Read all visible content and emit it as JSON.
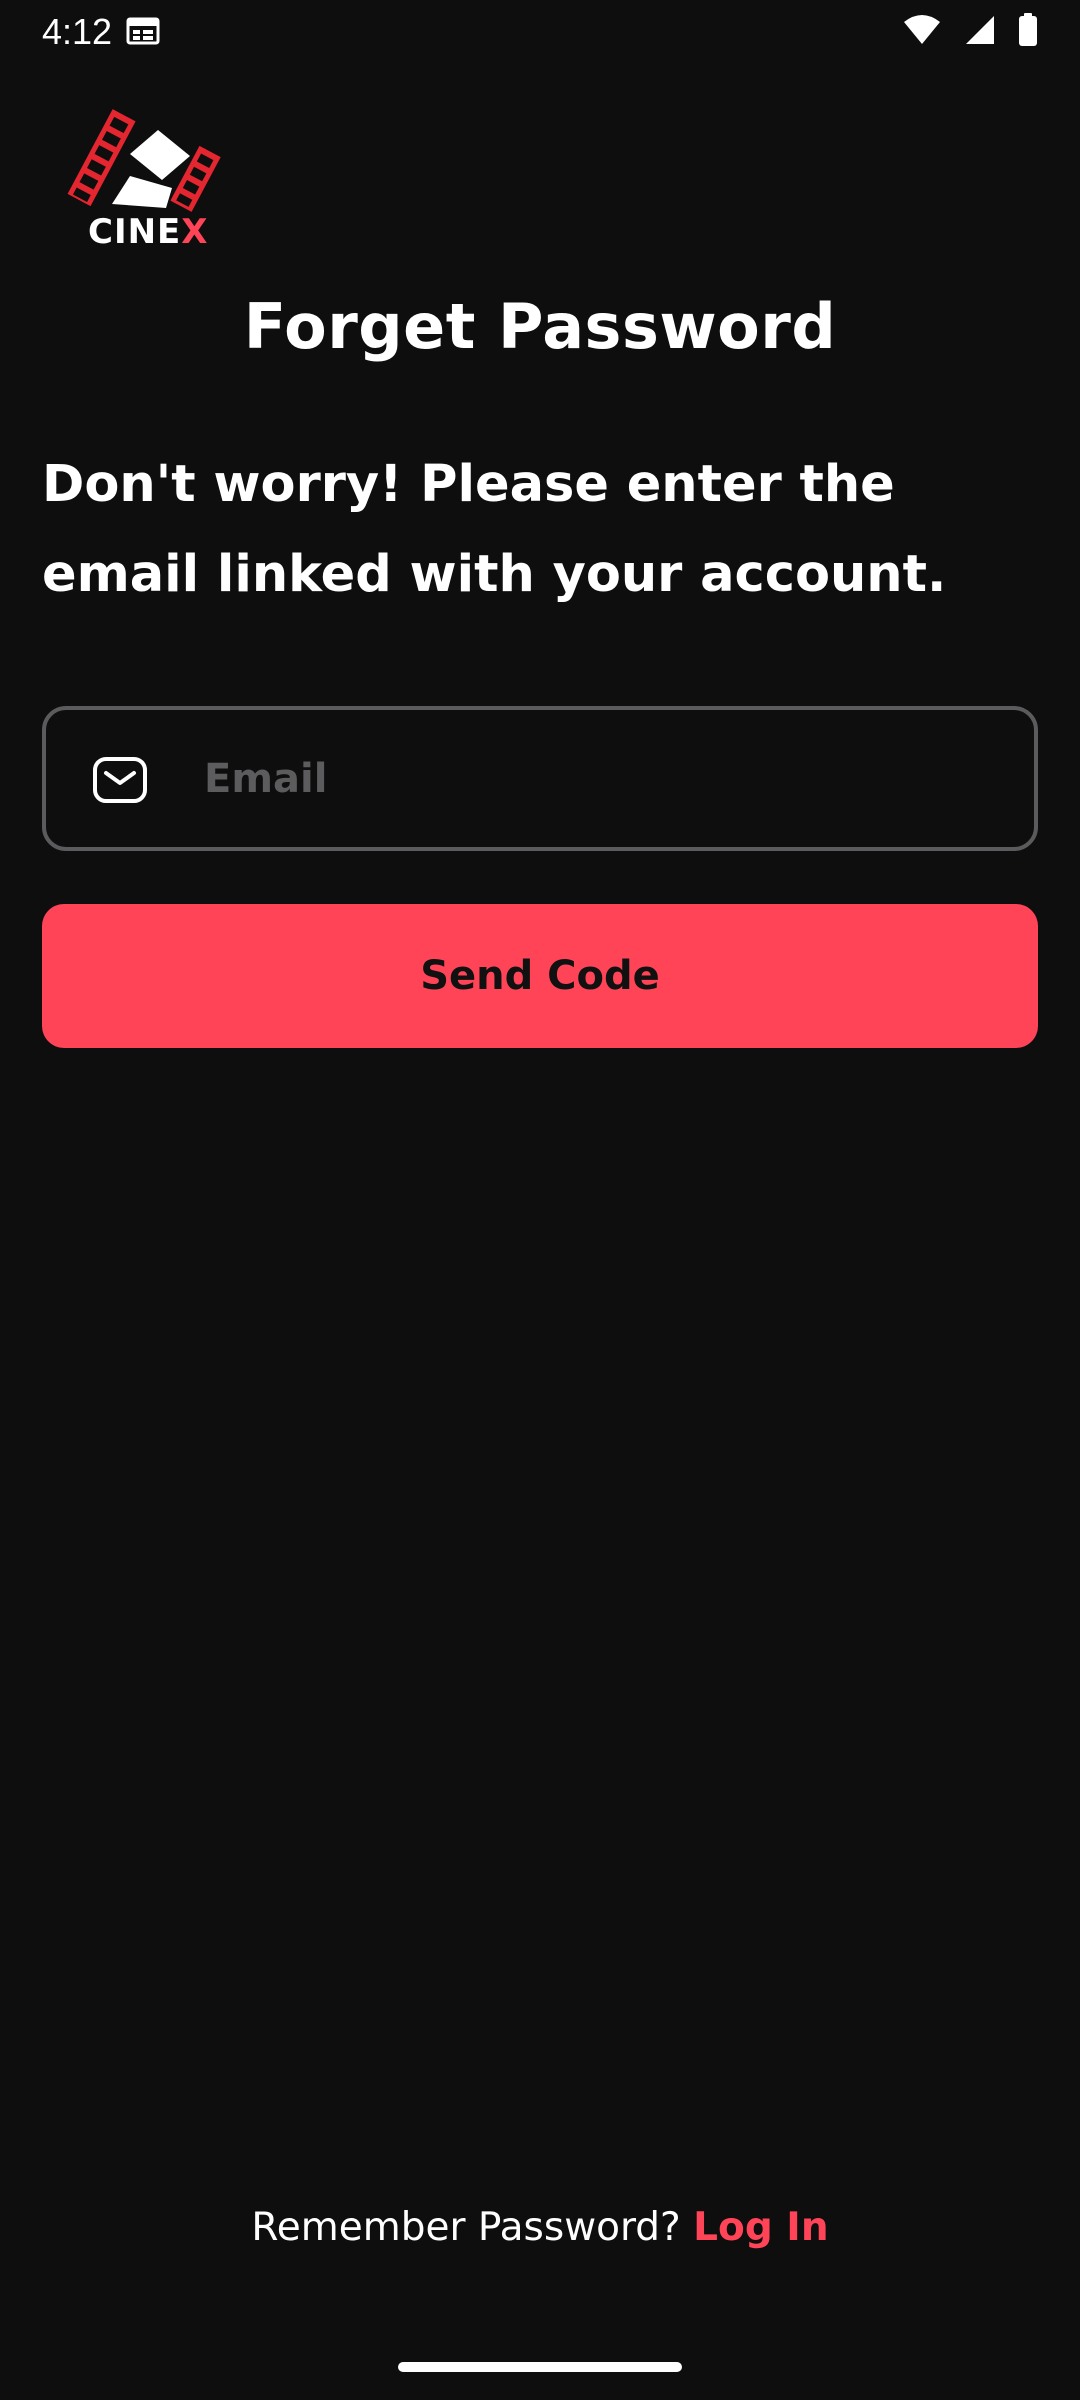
{
  "status_bar": {
    "time": "4:12",
    "icons": [
      "calendar-icon",
      "wifi-icon",
      "cellular-signal-icon",
      "battery-icon"
    ]
  },
  "logo": {
    "brand_prefix": "CINE",
    "brand_suffix": "X",
    "accent_color": "#ff4458"
  },
  "header": {
    "title": "Forget Password"
  },
  "main": {
    "instructions_line1": "Don't worry! Please enter the",
    "instructions_line2": "email linked with your account.",
    "email": {
      "icon": "mail-icon",
      "placeholder": "Email",
      "value": ""
    },
    "send_button_label": "Send Code"
  },
  "footer": {
    "prompt": "Remember Password?",
    "login_link": "Log In"
  },
  "colors": {
    "background": "#0e0e0f",
    "accent": "#ff4458",
    "field_border": "#5b5b5d",
    "placeholder": "#5c5c5e"
  }
}
